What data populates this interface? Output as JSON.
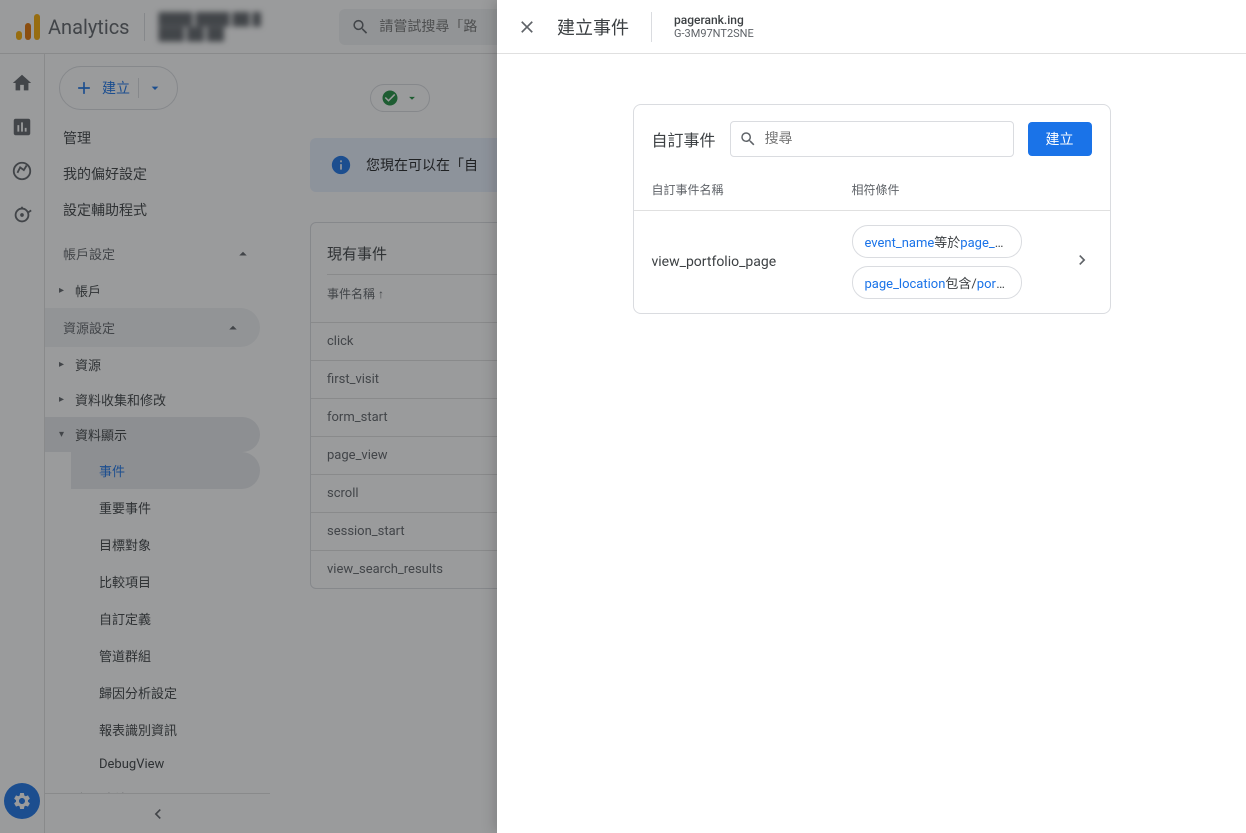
{
  "header": {
    "product": "Analytics",
    "search_placeholder": "請嘗試搜尋「路"
  },
  "sidebar": {
    "create": "建立",
    "admin": "管理",
    "prefs": "我的偏好設定",
    "setup": "設定輔助程式",
    "account_section": "帳戶設定",
    "account": "帳戶",
    "property_section": "資源設定",
    "property": "資源",
    "collection": "資料收集和修改",
    "display": "資料顯示",
    "display_items": {
      "events": "事件",
      "key_events": "重要事件",
      "audiences": "目標對象",
      "comparisons": "比較項目",
      "custom_defs": "自訂定義",
      "channel_groups": "管道群組",
      "attribution": "歸因分析設定",
      "reporting_id": "報表識別資訊",
      "debugview": "DebugView"
    },
    "product_links": "產品連結"
  },
  "main": {
    "banner": "您現在可以在「自",
    "table_title": "現有事件",
    "col_name": "事件名稱",
    "rows": [
      "click",
      "first_visit",
      "form_start",
      "page_view",
      "scroll",
      "session_start",
      "view_search_results"
    ]
  },
  "panel": {
    "title": "建立事件",
    "property_name": "pagerank.ing",
    "property_id": "G-3M97NT2SNE",
    "card_title": "自訂事件",
    "search_placeholder": "搜尋",
    "create_btn": "建立",
    "col_name": "自訂事件名稱",
    "col_cond": "相符條件",
    "row": {
      "name": "view_portfolio_page",
      "c1_key": "event_name",
      "c1_op": "等於",
      "c1_val": "page_vie…",
      "c2_key": "page_location",
      "c2_op": "包含",
      "c2_val_prefix": "/",
      "c2_val": "portf…"
    }
  }
}
